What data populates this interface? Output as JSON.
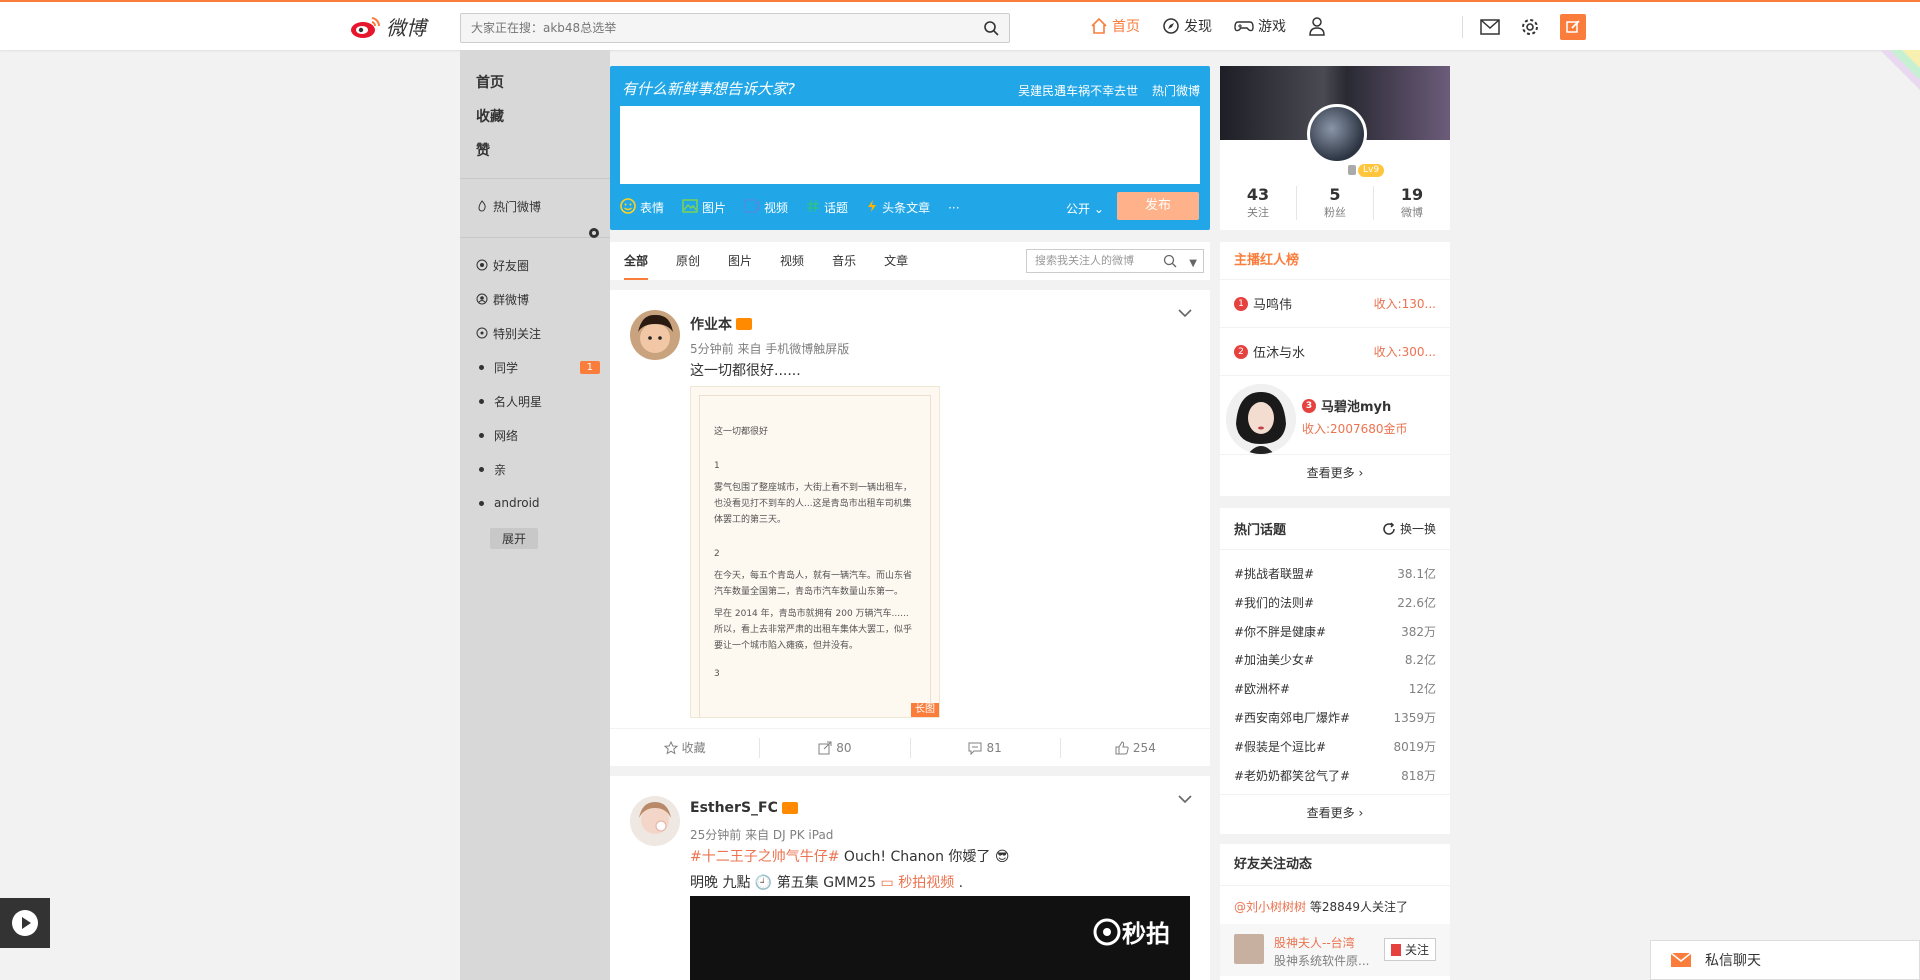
{
  "header": {
    "logo_text": "微博",
    "search_placeholder": "大家正在搜：akb48总选举",
    "nav": [
      {
        "label": "首页",
        "active": true
      },
      {
        "label": "发现"
      },
      {
        "label": "游戏"
      }
    ],
    "accent_color": "#fa7d3c"
  },
  "sidebar": {
    "main": [
      "首页",
      "收藏",
      "赞"
    ],
    "hot": "热门微博",
    "groups": [
      {
        "label": "好友圈",
        "icon": "target-icon"
      },
      {
        "label": "群微博",
        "icon": "group-icon"
      },
      {
        "label": "特别关注",
        "icon": "star-circle-icon"
      }
    ],
    "dot_items": [
      {
        "label": "同学",
        "badge": "1"
      },
      {
        "label": "名人明星"
      },
      {
        "label": "网络"
      },
      {
        "label": "亲"
      },
      {
        "label": "android"
      }
    ],
    "expand": "展开"
  },
  "publish": {
    "prompt": "有什么新鲜事想告诉大家?",
    "link1": "吴建民遇车祸不幸去世",
    "link2": "热门微博",
    "tools": [
      "表情",
      "图片",
      "视频",
      "话题",
      "头条文章"
    ],
    "more": "···",
    "scope": "公开",
    "send": "发布"
  },
  "tabs": {
    "items": [
      "全部",
      "原创",
      "图片",
      "视频",
      "音乐",
      "文章"
    ],
    "search_placeholder": "搜索我关注人的微博"
  },
  "posts": [
    {
      "name": "作业本",
      "meta": "5分钟前 来自 手机微博触屏版",
      "text": "这一切都很好......",
      "image_title": "这一切都很好",
      "image_paragraphs": [
        "1",
        "雾气包围了整座城市，大街上看不到一辆出租车，也没看见打不到车的人...这是青岛市出租车司机集体罢工的第三天。",
        "2",
        "在今天，每五个青岛人，就有一辆汽车。而山东省汽车数量全国第二，青岛市汽车数量山东第一。",
        "早在 2014 年，青岛市就拥有 200 万辆汽车......所以，看上去非常严肃的出租车集体大罢工，似乎要让一个城市陷入瘫痪，但并没有。",
        "3"
      ],
      "image_tag": "长图",
      "actions": {
        "collect": "收藏",
        "repost": "80",
        "comment": "81",
        "like": "254"
      }
    },
    {
      "name": "EstherS_FC",
      "meta": "25分钟前 来自 DJ PK iPad",
      "topic": "#十二王子之帅气牛仔#",
      "text1": " Ouch! Chanon 你嬡了",
      "text2": "明晚 九點",
      "text3": " 第五集 GMM25 ",
      "video_link": "秒拍视频",
      "video_brand": "秒拍"
    }
  ],
  "profile": {
    "level": "Lv9",
    "stats": [
      {
        "n": "43",
        "l": "关注"
      },
      {
        "n": "5",
        "l": "粉丝"
      },
      {
        "n": "19",
        "l": "微博"
      }
    ]
  },
  "ranking": {
    "title": "主播红人榜",
    "rows": [
      {
        "rank": "1",
        "name": "马鸣伟",
        "income": "收入:130..."
      },
      {
        "rank": "2",
        "name": "伍沐与水",
        "income": "收入:300..."
      }
    ],
    "top3": {
      "rank": "3",
      "name": "马碧池myh",
      "income": "收入:2007680金币"
    },
    "more": "查看更多"
  },
  "hot_topics": {
    "title": "热门话题",
    "refresh": "换一换",
    "items": [
      {
        "t": "#挑战者联盟#",
        "c": "38.1亿"
      },
      {
        "t": "#我们的法则#",
        "c": "22.6亿"
      },
      {
        "t": "#你不胖是健康#",
        "c": "382万"
      },
      {
        "t": "#加油美少女#",
        "c": "8.2亿"
      },
      {
        "t": "#欧洲杯#",
        "c": "12亿"
      },
      {
        "t": "#西安南郊电厂爆炸#",
        "c": "1359万"
      },
      {
        "t": "#假装是个逗比#",
        "c": "8019万"
      },
      {
        "t": "#老奶奶都笑岔气了#",
        "c": "818万"
      }
    ],
    "more": "查看更多"
  },
  "friends": {
    "title": "好友关注动态",
    "mention": "@刘小树树树",
    "mention_suffix": " 等28849人关注了",
    "name": "股神夫人--台湾",
    "desc": "股神系统软件原...",
    "follow": "关注"
  },
  "chat": "私信聊天"
}
